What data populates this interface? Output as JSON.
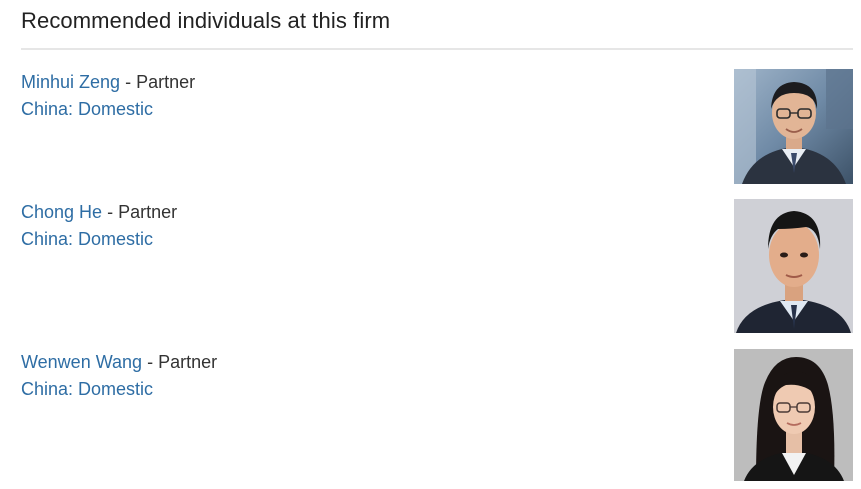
{
  "section": {
    "heading": "Recommended individuals at this firm"
  },
  "people": [
    {
      "name": "Minhui Zeng",
      "separator": " - ",
      "role": "Partner",
      "practice": "China: Domestic"
    },
    {
      "name": "Chong He",
      "separator": " - ",
      "role": "Partner",
      "practice": "China: Domestic"
    },
    {
      "name": "Wenwen Wang",
      "separator": " - ",
      "role": "Partner",
      "practice": "China: Domestic"
    }
  ],
  "colors": {
    "link": "#2e6da4",
    "text": "#333333",
    "heading": "#222222",
    "divider": "#e6e6e6"
  }
}
